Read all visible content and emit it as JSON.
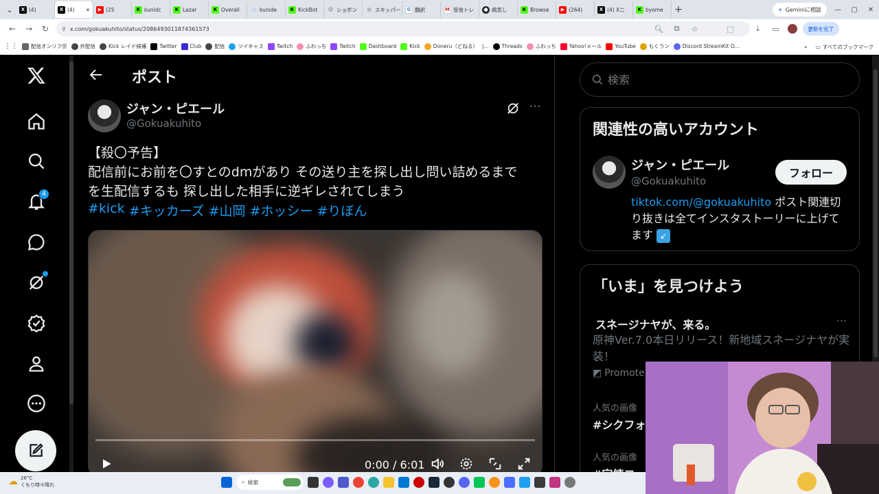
{
  "browser": {
    "tabs": [
      {
        "label": "(4)",
        "icon": "x-logo"
      },
      {
        "label": "(4)",
        "icon": "x-logo"
      },
      {
        "label": "(25",
        "icon": "youtube"
      },
      {
        "label": "kunidc",
        "icon": "kick"
      },
      {
        "label": "Lazar",
        "icon": "kick"
      },
      {
        "label": "Overall",
        "icon": "kick"
      },
      {
        "label": "kunide",
        "icon": "loader"
      },
      {
        "label": "KickBot",
        "icon": "kick"
      },
      {
        "label": "ショボン",
        "icon": "face"
      },
      {
        "label": "スキッパー",
        "icon": "globe"
      },
      {
        "label": "翻訳",
        "icon": "google"
      },
      {
        "label": "受信トレ",
        "icon": "gmail"
      },
      {
        "label": "病気し",
        "icon": "github"
      },
      {
        "label": "Browse",
        "icon": "kick"
      },
      {
        "label": "(264)",
        "icon": "youtube"
      },
      {
        "label": "(4) X二",
        "icon": "x-logo"
      },
      {
        "label": "byome",
        "icon": "kick"
      }
    ],
    "gemini_button": "Geminiに相談",
    "url": "x.com/gokuakuhito/status/2086493011874361573",
    "update_button": "更新を完了",
    "bookmarks": [
      "配信オンリフ宗",
      "外配信",
      "Kick レイド候補",
      "Twitter",
      "Club",
      "配信",
      "ツイキャス",
      "Twitch",
      "ふわっち",
      "Twitch",
      "Dashboard",
      "Kick",
      "Doneru（どねる）",
      "|...",
      "Threads",
      "ふわっち",
      "Yahoo!メール",
      "YouTube",
      "もくラン",
      "Discord StreamKit O..."
    ],
    "all_bookmarks": "すべてのブックマーク"
  },
  "nav": {
    "notifications_count": "4"
  },
  "post": {
    "header_title": "ポスト",
    "author_name": "ジャン・ピエール",
    "author_handle": "@Gokuakuhito",
    "text_lines": [
      "【殺〇予告】",
      "配信前にお前を〇すとのdmがあり その送り主を探し出し問い詰めるまで",
      "を生配信するも 探し出した相手に逆ギレされてしまう"
    ],
    "hashtags": [
      "#kick",
      "#キッカーズ",
      "#山岡",
      "#ホッシー",
      "#りぼん"
    ],
    "video_time": "0:00 / 6:01",
    "video_progress": 0.0
  },
  "sidebar": {
    "search_placeholder": "検索",
    "related_title": "関連性の高いアカウント",
    "related_name": "ジャン・ピエール",
    "related_handle": "@Gokuakuhito",
    "follow_label": "フォロー",
    "bio_link": "tiktok.com/@gokuakuhito",
    "bio_text": " ポスト関連切り抜きは全てインスタストーリーに上げてます",
    "bio_emoji": "↙",
    "explore_title": "「いま」を見つけよう",
    "trend1_title": "スネージナヤが、来る。",
    "trend1_desc": "原神Ver.7.0本日リリース！新地域スネージナヤが実装！",
    "trend1_promoted": "Promote",
    "trend2_category": "人気の画像",
    "trend2_title": "#シクフォ",
    "trend3_category": "人気の画像",
    "trend3_title": "#宗練コ"
  },
  "taskbar": {
    "temperature": "26°C",
    "weather": "くもり時々晴れ",
    "search_label": "検索"
  },
  "colors": {
    "accent": "#1d9bf0",
    "background": "#000000",
    "text": "#e7e9ea",
    "muted": "#71767b",
    "border": "#2f3336"
  }
}
